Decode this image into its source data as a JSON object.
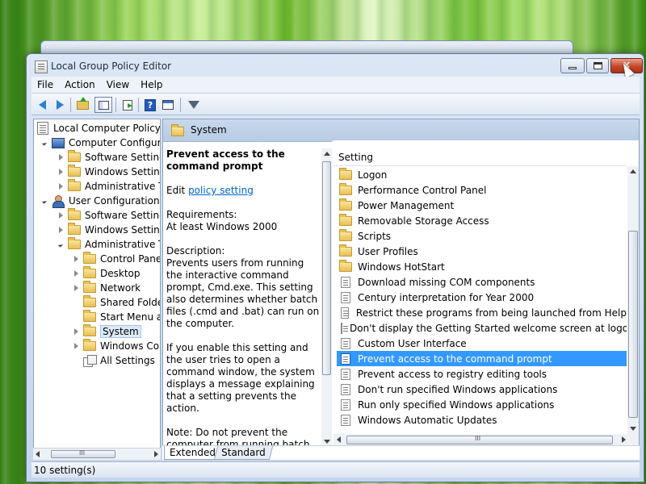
{
  "window": {
    "title": "Local Group Policy Editor",
    "close_glyph": "✕"
  },
  "menu": [
    "File",
    "Action",
    "View",
    "Help"
  ],
  "toolbar": {
    "icons": [
      "back-arrow-icon",
      "forward-arrow-icon",
      "up-folder-icon",
      "show-hide-tree-icon",
      "export-list-icon",
      "help-icon",
      "properties-icon",
      "filter-icon"
    ],
    "help_glyph": "?"
  },
  "tree": {
    "items": [
      {
        "label": "Local Computer Policy",
        "icon": "policy-icon"
      },
      {
        "label": "Computer Configura",
        "icon": "computer-icon",
        "expanded": true
      },
      {
        "label": "Software Settings",
        "icon": "folder-icon"
      },
      {
        "label": "Windows Setting",
        "icon": "folder-icon"
      },
      {
        "label": "Administrative Te",
        "icon": "folder-icon"
      },
      {
        "label": "User Configuration",
        "icon": "user-icon",
        "expanded": true
      },
      {
        "label": "Software Settings",
        "icon": "folder-icon"
      },
      {
        "label": "Windows Setting",
        "icon": "folder-icon"
      },
      {
        "label": "Administrative Te",
        "icon": "folder-icon",
        "expanded": true
      },
      {
        "label": "Control Panel",
        "icon": "folder-icon"
      },
      {
        "label": "Desktop",
        "icon": "folder-icon"
      },
      {
        "label": "Network",
        "icon": "folder-icon"
      },
      {
        "label": "Shared Folder",
        "icon": "folder-icon"
      },
      {
        "label": "Start Menu ar",
        "icon": "folder-icon"
      },
      {
        "label": "System",
        "icon": "folder-icon",
        "selected": true
      },
      {
        "label": "Windows Cor",
        "icon": "folder-icon"
      },
      {
        "label": "All Settings",
        "icon": "all-settings-icon"
      }
    ],
    "scroll_glyph": "III"
  },
  "content": {
    "header_title": "System",
    "description": {
      "title": "Prevent access to the command prompt",
      "edit_prefix": "Edit ",
      "edit_link": "policy setting",
      "requirements_label": "Requirements:",
      "requirements_value": "At least Windows 2000",
      "description_label": "Description:",
      "description_body": "Prevents users from running the interactive command prompt, Cmd.exe. This setting also determines whether batch files (.cmd and .bat) can run on the computer.",
      "paragraph2": "If you enable this setting and the user tries to open a command window, the system displays a message explaining that a setting prevents the action.",
      "note": "Note: Do not prevent the computer from running batch"
    },
    "list": {
      "column_header": "Setting",
      "rows": [
        {
          "label": "Logon",
          "type": "folder"
        },
        {
          "label": "Performance Control Panel",
          "type": "folder"
        },
        {
          "label": "Power Management",
          "type": "folder"
        },
        {
          "label": "Removable Storage Access",
          "type": "folder"
        },
        {
          "label": "Scripts",
          "type": "folder"
        },
        {
          "label": "User Profiles",
          "type": "folder"
        },
        {
          "label": "Windows HotStart",
          "type": "folder"
        },
        {
          "label": "Download missing COM components",
          "type": "setting"
        },
        {
          "label": "Century interpretation for Year 2000",
          "type": "setting"
        },
        {
          "label": "Restrict these programs from being launched from Help",
          "type": "setting"
        },
        {
          "label": "Don't display the Getting Started welcome screen at logon",
          "type": "setting"
        },
        {
          "label": "Custom User Interface",
          "type": "setting"
        },
        {
          "label": "Prevent access to the command prompt",
          "type": "setting",
          "selected": true
        },
        {
          "label": "Prevent access to registry editing tools",
          "type": "setting"
        },
        {
          "label": "Don't run specified Windows applications",
          "type": "setting"
        },
        {
          "label": "Run only specified Windows applications",
          "type": "setting"
        },
        {
          "label": "Windows Automatic Updates",
          "type": "setting"
        }
      ],
      "scroll_glyph": "III"
    },
    "tabs": {
      "extended": "Extended",
      "standard": "Standard"
    }
  },
  "status": {
    "text": "10 setting(s)"
  },
  "colors": {
    "selection": "#3399ff",
    "link": "#0066cc",
    "desktop_green": "#5aa31c"
  }
}
